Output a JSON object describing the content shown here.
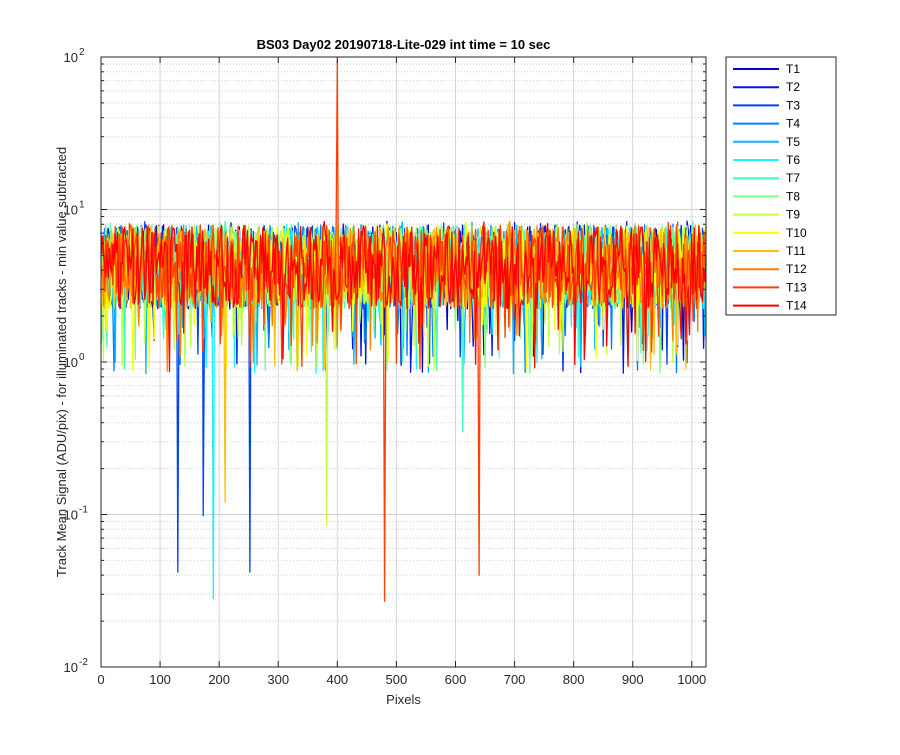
{
  "chart_data": {
    "type": "line",
    "title": "BS03 Day02 20190718-Lite-029 int time = 10 sec",
    "xlabel": "Pixels",
    "ylabel": "Track Mean Signal (ADU/pix) - for illuminated tracks - min value subtracted",
    "xlim": [
      0,
      1024
    ],
    "ylim": [
      0.01,
      100
    ],
    "yscale": "log",
    "grid": true,
    "minor_grid": true,
    "legend_position": "outside-top-right",
    "x_ticks": [
      "0",
      "100",
      "200",
      "300",
      "400",
      "500",
      "600",
      "700",
      "800",
      "900",
      "1000"
    ],
    "x_tick_values": [
      0,
      100,
      200,
      300,
      400,
      500,
      600,
      700,
      800,
      900,
      1000
    ],
    "y_ticks": [
      {
        "base": "10",
        "exp": "-2",
        "value": 0.01
      },
      {
        "base": "10",
        "exp": "-1",
        "value": 0.1
      },
      {
        "base": "10",
        "exp": "0",
        "value": 1
      },
      {
        "base": "10",
        "exp": "1",
        "value": 10
      },
      {
        "base": "10",
        "exp": "2",
        "value": 100
      }
    ],
    "series": [
      {
        "name": "T1",
        "color": "#0000c8",
        "typical": 4.2
      },
      {
        "name": "T2",
        "color": "#0018e0",
        "typical": 4.2
      },
      {
        "name": "T3",
        "color": "#0045f0",
        "typical": 4.2
      },
      {
        "name": "T4",
        "color": "#0080ff",
        "typical": 4.2
      },
      {
        "name": "T5",
        "color": "#00b8ff",
        "typical": 4.2
      },
      {
        "name": "T6",
        "color": "#1ff0ff",
        "typical": 4.2
      },
      {
        "name": "T7",
        "color": "#40ffbf",
        "typical": 4.2
      },
      {
        "name": "T8",
        "color": "#80ff80",
        "typical": 4.2
      },
      {
        "name": "T9",
        "color": "#bfff40",
        "typical": 4.2
      },
      {
        "name": "T10",
        "color": "#ffff00",
        "typical": 4.2
      },
      {
        "name": "T11",
        "color": "#ffc000",
        "typical": 4.2
      },
      {
        "name": "T12",
        "color": "#ff8000",
        "typical": 4.2
      },
      {
        "name": "T13",
        "color": "#ff4000",
        "typical": 4.2
      },
      {
        "name": "T14",
        "color": "#ff0000",
        "typical": 4.2
      }
    ],
    "notable_points": [
      {
        "series": "T13",
        "x": 400,
        "y": 95
      },
      {
        "series": "T13",
        "x": 480,
        "y": 0.027
      },
      {
        "series": "T13",
        "x": 640,
        "y": 0.04
      },
      {
        "series": "T6",
        "x": 190,
        "y": 0.028
      },
      {
        "series": "T3",
        "x": 130,
        "y": 0.042
      },
      {
        "series": "T3",
        "x": 252,
        "y": 0.042
      },
      {
        "series": "T3",
        "x": 173,
        "y": 0.098
      },
      {
        "series": "T9",
        "x": 382,
        "y": 0.085
      },
      {
        "series": "T11",
        "x": 210,
        "y": 0.12
      },
      {
        "series": "T7",
        "x": 612,
        "y": 0.35
      }
    ]
  }
}
